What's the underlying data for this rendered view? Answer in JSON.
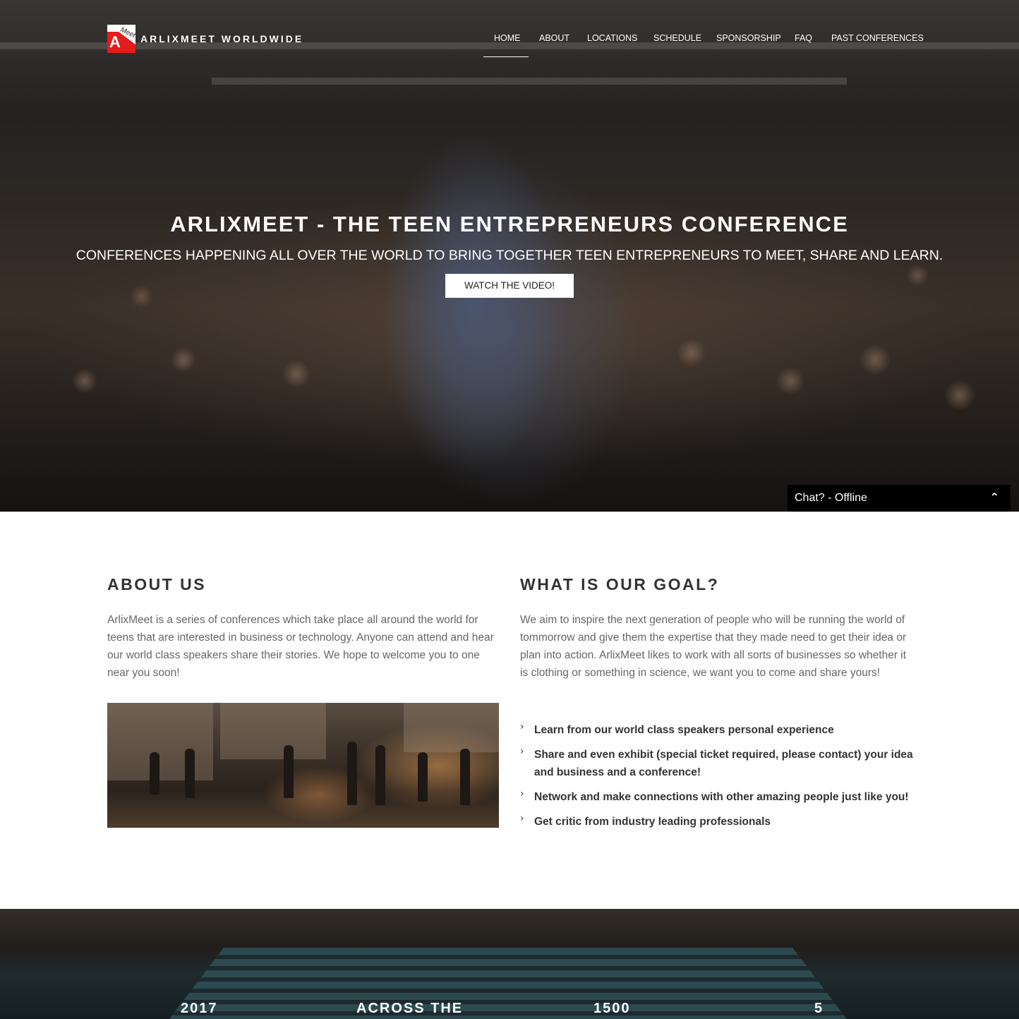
{
  "header": {
    "logo_letter": "A",
    "logo_small": "Meet",
    "brand": "ARLIXMEET WORLDWIDE",
    "nav": [
      {
        "label": "HOME",
        "active": true
      },
      {
        "label": "ABOUT"
      },
      {
        "label": "LOCATIONS"
      },
      {
        "label": "SCHEDULE"
      },
      {
        "label": "SPONSORSHIP"
      },
      {
        "label": "FAQ"
      },
      {
        "label": "PAST CONFERENCES"
      }
    ]
  },
  "hero": {
    "title": "ARLIXMEET - THE TEEN ENTREPRENEURS CONFERENCE",
    "subtitle": "CONFERENCES HAPPENING ALL OVER THE WORLD TO BRING TOGETHER TEEN ENTREPRENEURS TO MEET, SHARE AND LEARN.",
    "button": "WATCH THE VIDEO!"
  },
  "chat": {
    "label": "Chat? - Offline",
    "icon": "chevron-up-icon"
  },
  "about": {
    "heading": "ABOUT US",
    "text": "ArlixMeet is a series of conferences which take place all around the world for teens that are interested in business or technology. Anyone can attend and hear our world class speakers share their stories. We hope to welcome you to one near you soon!"
  },
  "goal": {
    "heading": "WHAT IS OUR GOAL?",
    "text": "We aim to inspire the next generation of people who will be running the world of tommorrow and give them the expertise that they made need to get their idea or plan into action. ArlixMeet likes to work with all sorts of businesses so whether it is clothing or something in science, we want you to come and share yours!",
    "items": [
      "Learn from our world class speakers personal experience",
      "Share and even exhibit (special ticket required, please contact) your idea and business and a conference!",
      "Network and make connections with other amazing people just like you!",
      "Get critic from industry leading professionals"
    ],
    "item_icon": "chevron-right-icon"
  },
  "stats": [
    "2017",
    "ACROSS THE",
    "1500",
    "5"
  ],
  "colors": {
    "accent_red": "#e31c1c",
    "chat_bg": "#000000",
    "heading": "#333333",
    "body_text": "#666666"
  }
}
